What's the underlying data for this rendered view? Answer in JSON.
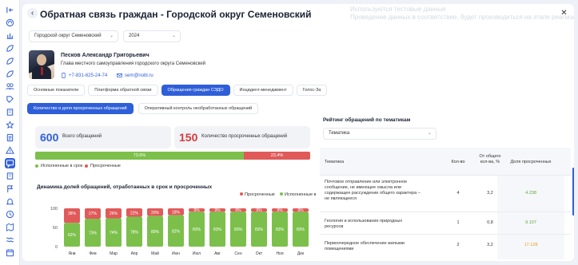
{
  "window": {
    "title": "Обратная связь граждан - Городской округ Семеновский",
    "watermark_line1": "Используются тестовые данные",
    "watermark_line2": "Проведение данных в соответствие, будет производиться на этапе реализации модуля"
  },
  "filters": {
    "district": "Городской округ Семеновский",
    "year": "2024"
  },
  "person": {
    "name": "Песков Александр Григорьевич",
    "position": "Глава местного самоуправления городского округа Семеновский",
    "phone": "+7-831-625-24-74",
    "email": "sem@nobl.ru"
  },
  "tabs": [
    "Основные показатели",
    "Платформа обратной связи",
    "Обращения граждан СЭДО",
    "Инцидент-менеджмент",
    "Голос-За"
  ],
  "active_tab": 2,
  "subtabs": [
    "Количество и доля просроченных обращений",
    "Оперативный контроль необработанных обращений"
  ],
  "active_subtab": 0,
  "stats": {
    "total_value": "600",
    "total_label": "Всего обращений",
    "overdue_value": "150",
    "overdue_label": "Количество просроченных обращений",
    "ontime_pct": 73.6,
    "ontime_pct_label": "73,6%",
    "overdue_pct": 23.4,
    "overdue_pct_label": "23,4%",
    "legend_ontime": "Исполненные в срок",
    "legend_overdue": "Просроченные"
  },
  "colors": {
    "accent": "#2f5fd8",
    "green": "#7cc04b",
    "red": "#e05a5a"
  },
  "chart_data": {
    "type": "bar",
    "title": "Динамика долей обращений, отработанных в срок и просроченных",
    "legend": [
      "Просроченные",
      "Исполненные в срок"
    ],
    "legend_position": "top-right",
    "categories": [
      "Янв",
      "Фев",
      "Мар",
      "Апр",
      "Май",
      "Июн",
      "Июл",
      "Авг",
      "Сен",
      "Окт",
      "Ноя",
      "Дек"
    ],
    "yticks": [
      "100",
      "50",
      "0"
    ],
    "ylim": [
      0,
      100
    ],
    "series": [
      {
        "name": "Просроченные",
        "values": [
          38,
          27,
          26,
          22,
          20,
          18,
          9,
          9,
          9,
          9,
          9,
          9
        ],
        "labels": [
          "38%",
          "27%",
          "26%",
          "22%",
          "20%",
          "18%",
          "9%",
          "9%",
          "9%",
          "9%",
          "9%",
          "9%"
        ]
      },
      {
        "name": "Исполненные в срок",
        "values": [
          62,
          73,
          74,
          78,
          80,
          82,
          91,
          91,
          91,
          91,
          91,
          91
        ],
        "labels": [
          "62%",
          "73%",
          "74%",
          "78%",
          "80%",
          "82%",
          "83%",
          "83%",
          "83%",
          "83%",
          "83%",
          "83%"
        ]
      }
    ]
  },
  "rating": {
    "title": "Рейтинг обращений по тематикам",
    "filter": "Тематика",
    "headers": [
      "Тематика",
      "Кол-во",
      "От общего кол-ва, %",
      "Доля просроченных"
    ],
    "rows": [
      {
        "topic": "Почтовое отправление или электронное сообщение, не имеющее смысла или содержащее рассуждение общего характера – не являющееся",
        "count": "4",
        "share": "3,2",
        "overdue": "4.238"
      },
      {
        "topic": "Геология и использование природных ресурсов",
        "count": "1",
        "share": "0,8",
        "overdue": "9.107"
      },
      {
        "topic": "Первоочередное обеспечение жилыми помещениями",
        "count": "2",
        "share": "3,2",
        "overdue": "17.128"
      }
    ]
  },
  "sidebar": {
    "icons": [
      "collapse-icon",
      "home-icon",
      "grid-icon",
      "leaf-icon",
      "leaf-icon",
      "leaf-icon",
      "people-icon",
      "tag-icon",
      "building-icon",
      "star-icon",
      "document-icon",
      "alert-icon",
      "chat-icon",
      "building-icon",
      "flag-icon",
      "bell-icon",
      "clock-icon",
      "map-icon",
      "wave-icon",
      "calendar-icon"
    ]
  }
}
